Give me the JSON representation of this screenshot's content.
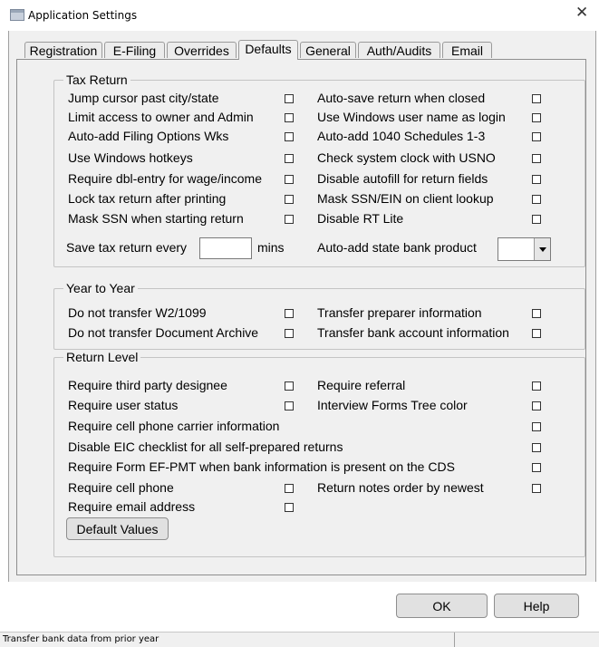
{
  "window": {
    "title": "Application Settings",
    "close_glyph": "✕"
  },
  "tabs": [
    "Registration",
    "E-Filing",
    "Overrides",
    "Defaults",
    "General",
    "Auth/Audits",
    "Email"
  ],
  "active_tab": "Defaults",
  "tax_return": {
    "legend": "Tax Return",
    "left": [
      "Jump cursor past city/state",
      "Limit access to owner and Admin",
      "Auto-add Filing Options Wks",
      "Use Windows hotkeys",
      "Require dbl-entry for wage/income",
      "Lock tax return after printing",
      "Mask SSN when starting return"
    ],
    "right": [
      "Auto-save return when closed",
      "Use Windows user name as login",
      "Auto-add 1040 Schedules 1-3",
      "Check system clock with USNO",
      "Disable autofill for return fields",
      "Mask SSN/EIN on client lookup",
      "Disable RT Lite"
    ],
    "save_every_label": "Save tax return every",
    "save_every_value": "",
    "mins_label": "mins",
    "state_bank_label": "Auto-add state bank product",
    "state_bank_value": ""
  },
  "year_to_year": {
    "legend": "Year to Year",
    "left": [
      "Do not transfer W2/1099",
      "Do not transfer Document Archive"
    ],
    "right": [
      "Transfer preparer information",
      "Transfer bank account information"
    ]
  },
  "return_level": {
    "legend": "Return Level",
    "third_party": "Require third party designee",
    "referral": "Require referral",
    "user_status": "Require user status",
    "forms_tree_color": "Interview Forms Tree color",
    "cell_carrier": "Require cell phone carrier information",
    "disable_eic": "Disable EIC checklist for all self-prepared returns",
    "ef_pmt": "Require Form EF-PMT when bank information is present on the CDS",
    "cell_phone": "Require cell phone",
    "notes_order": "Return notes order by newest",
    "email": "Require email address",
    "default_values_button": "Default Values"
  },
  "buttons": {
    "ok": "OK",
    "help": "Help"
  },
  "status": {
    "text": "Transfer bank data from prior year"
  },
  "icons": {
    "app": "settings-window-icon",
    "close": "close-icon",
    "dropdown": "chevron-down-icon"
  },
  "colors": {
    "background": "#f0f0f0",
    "button": "#e1e1e1",
    "border": "#8e8e8e"
  }
}
